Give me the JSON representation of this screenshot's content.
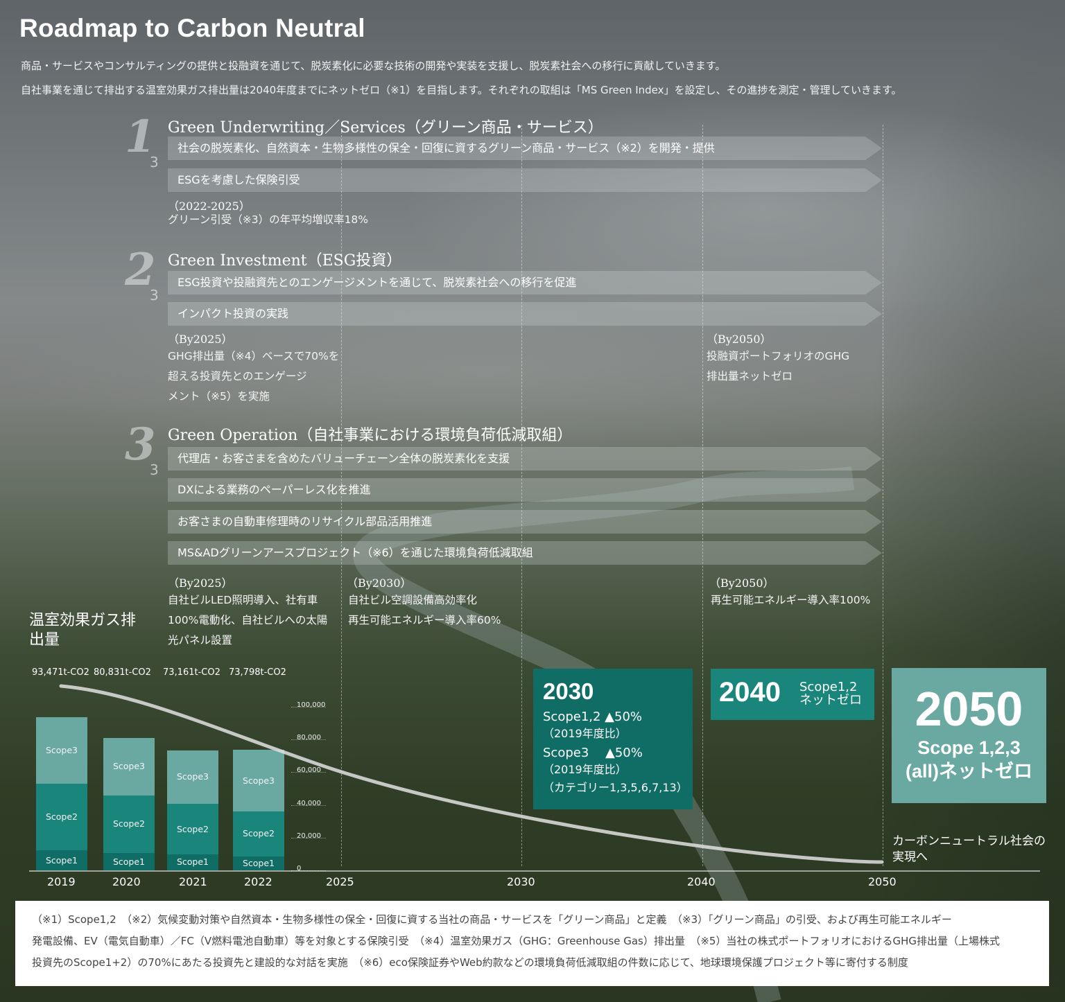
{
  "title": "Roadmap to Carbon Neutral",
  "intro": [
    "商品・サービスやコンサルティングの提供と投融資を通じて、脱炭素化に必要な技術の開発や実装を支援し、脱炭素社会への移行に貢献していきます。",
    "自社事業を通じて排出する温室効果ガス排出量は2040年度までにネットゼロ（※1）を目指します。それぞれの取組は「MS Green Index」を設定し、その進捗を測定・管理していきます。"
  ],
  "sections": [
    {
      "num": "1",
      "of": "3",
      "title": "Green Underwriting／Services（グリーン商品・サービス）",
      "bars": [
        "社会の脱炭素化、自然資本・生物多様性の保全・回復に資するグリーン商品・サービス（※2）を開発・提供",
        "ESGを考慮した保険引受"
      ],
      "goal_head": "（2022-2025）",
      "goal_text": "グリーン引受（※3）の年平均増収率18%"
    },
    {
      "num": "2",
      "of": "3",
      "title": "Green Investment（ESG投資）",
      "bars": [
        "ESG投資や投融資先とのエンゲージメントを通じて、脱炭素社会への移行を促進",
        "インパクト投資の実践"
      ],
      "goal_2025_head": "（By2025）",
      "goal_2025_lines": [
        "GHG排出量（※4）ベースで70%を",
        "超える投資先とのエンゲージ",
        "メント（※5）を実施"
      ],
      "goal_2050_head": "（By2050）",
      "goal_2050_lines": [
        "投融資ポートフォリオのGHG",
        "排出量ネットゼロ"
      ]
    },
    {
      "num": "3",
      "of": "3",
      "title": "Green Operation（自社事業における環境負荷低減取組）",
      "bars": [
        "代理店・お客さまを含めたバリューチェーン全体の脱炭素化を支援",
        "DXによる業務のペーパーレス化を推進",
        "お客さまの自動車修理時のリサイクル部品活用推進",
        "MS&ADグリーンアースプロジェクト（※6）を通じた環境負荷低減取組"
      ],
      "goal_2025_head": "（By2025）",
      "goal_2025_lines": [
        "自社ビルLED照明導入、社有車",
        "100%電動化、自社ビルへの太陽",
        "光パネル設置"
      ],
      "goal_2030_head": "（By2030）",
      "goal_2030_lines": [
        "自社ビル空調設備高効率化",
        "再生可能エネルギー導入率60%"
      ],
      "goal_2050_head": "（By2050）",
      "goal_2050_lines": [
        "再生可能エネルギー導入率100%"
      ]
    }
  ],
  "chart_data": {
    "type": "bar",
    "title": "温室効果ガス排出量",
    "categories": [
      "2019",
      "2020",
      "2021",
      "2022"
    ],
    "totals": [
      93471,
      80831,
      73161,
      73798
    ],
    "total_labels": [
      "93,471t-CO2",
      "80,831t-CO2",
      "73,161t-CO2",
      "73,798t-CO2"
    ],
    "series": [
      {
        "name": "Scope1",
        "values": [
          12300,
          10800,
          9600,
          8500
        ]
      },
      {
        "name": "Scope2",
        "values": [
          40500,
          35000,
          31200,
          27500
        ]
      },
      {
        "name": "Scope3",
        "values": [
          40671,
          35031,
          32361,
          37798
        ]
      }
    ],
    "yticks": [
      "100,000",
      "80,000",
      "60,000",
      "40,000",
      "20,000",
      "0"
    ],
    "ylim": [
      0,
      100000
    ],
    "timeline": [
      "2019",
      "2020",
      "2021",
      "2022",
      "2025",
      "2030",
      "2040",
      "2050"
    ]
  },
  "targets": {
    "t2030": {
      "year": "2030",
      "l1": "Scope1,2 ▲50%",
      "l1_sub": "（2019年度比）",
      "l2": "Scope3　 ▲50%",
      "l2_sub": "（2019年度比）",
      "l2_sub2": "（カテゴリー1,3,5,6,7,13）"
    },
    "t2040": {
      "year": "2040",
      "l1": "Scope1,2",
      "l2": "ネットゼロ"
    },
    "t2050": {
      "year": "2050",
      "l1": "Scope 1,2,3",
      "l2": "(all)ネットゼロ"
    },
    "final": [
      "カーボンニュートラル社会の",
      "実現へ"
    ]
  },
  "notes": [
    "（※1）Scope1,2　（※2）気候変動対策や自然資本・生物多様性の保全・回復に資する当社の商品・サービスを「グリーン商品」と定義　（※3）「グリーン商品」の引受、および再生可能エネルギー",
    "発電設備、EV（電気自動車）／FC（V燃料電池自動車）等を対象とする保険引受　（※4）温室効果ガス（GHG：Greenhouse Gas）排出量　（※5）当社の株式ポートフォリオにおけるGHG排出量（上場株式",
    "投資先のScope1+2）の70%にあたる投資先と建設的な対話を実施　（※6）eco保険証券やWeb約款などの環境負荷低減取組の件数に応じて、地球環境保護プロジェクト等に寄付する制度"
  ],
  "colors": {
    "scope1": "#0f6d66",
    "scope2": "#1a857b",
    "scope3": "#6aa9a2",
    "card2030": "#0f6d66",
    "card2040": "#1a857b",
    "card2050": "#6aa9a2"
  }
}
